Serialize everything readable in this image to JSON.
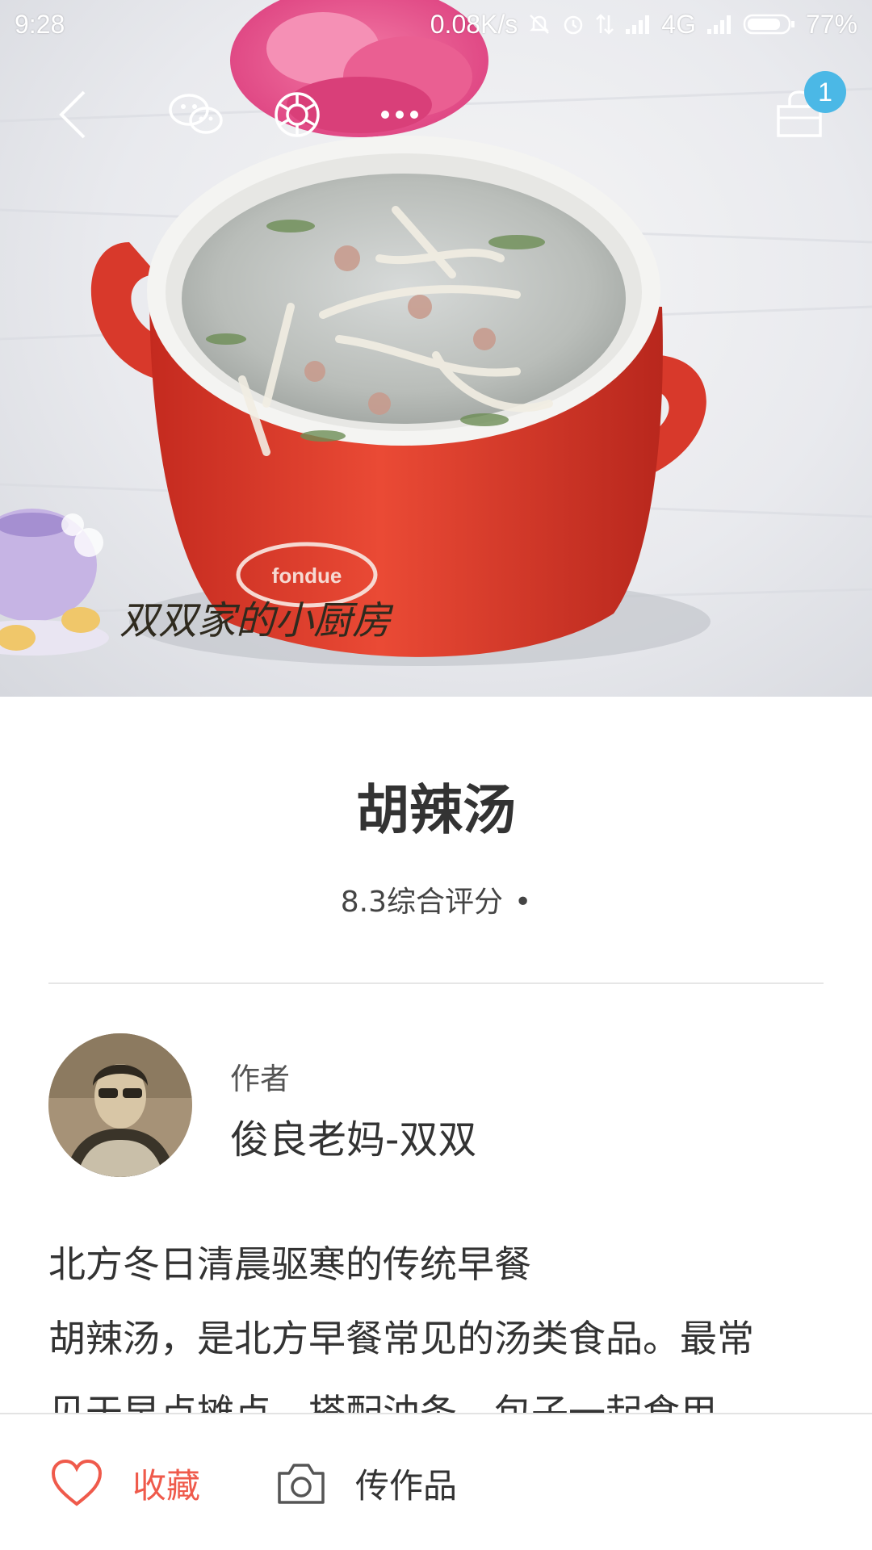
{
  "status_bar": {
    "time": "9:28",
    "network_speed": "0.08K/s",
    "network_type": "4G",
    "battery": "77%",
    "icons": [
      "mute-icon",
      "alarm-icon",
      "data-transfer-icon",
      "signal-icon",
      "signal-icon",
      "battery-icon"
    ]
  },
  "hero": {
    "watermark": "双双家的小厨房",
    "bowl_text": "fondue"
  },
  "topbar": {
    "icons": [
      "back-icon",
      "wechat-icon",
      "moments-icon",
      "more-icon",
      "cart-icon"
    ],
    "cart_count": "1"
  },
  "recipe": {
    "title": "胡辣汤",
    "rating": "8.3综合评分",
    "rating_suffix": "•"
  },
  "author": {
    "label": "作者",
    "name": "俊良老妈-双双"
  },
  "description": {
    "line1": "北方冬日清晨驱寒的传统早餐",
    "line2": "胡辣汤，是北方早餐常见的汤类食品。最常",
    "line3": "见于早点摊点，搭配油条、包子一起食用。"
  },
  "bottom_bar": {
    "favorite_label": "收藏",
    "upload_label": "传作品"
  },
  "colors": {
    "accent": "#ef5a4b",
    "badge": "#4bb8e6",
    "bowl_red": "#d8392b"
  }
}
